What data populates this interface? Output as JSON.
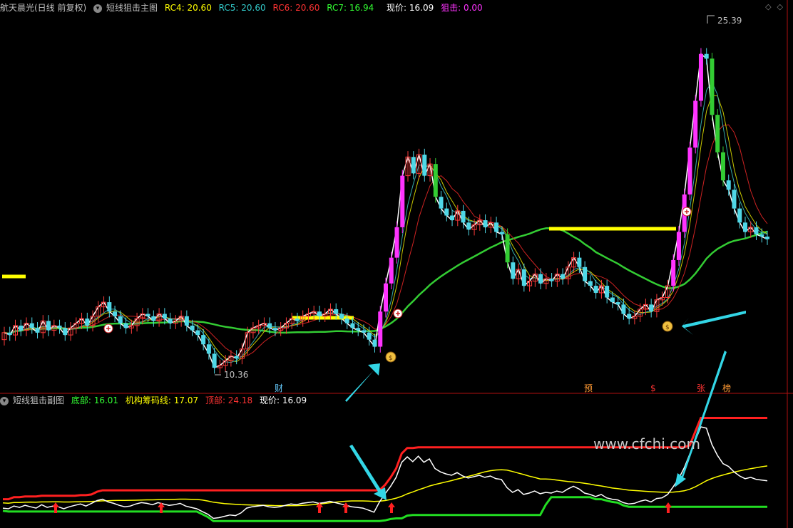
{
  "main_header": {
    "stock_title": "航天晨光(日线 前复权)",
    "indicator_name": "短线狙击主图",
    "rc4_label": "RC4: 20.60",
    "rc5_label": "RC5: 20.60",
    "rc6_label": "RC6: 20.60",
    "rc7_label": "RC7: 16.94",
    "price_label": "现价: 16.09",
    "snipe_label": "狙击: 0.00",
    "colors": {
      "rc4": "#ffff00",
      "rc5": "#33cccc",
      "rc6": "#ff3333",
      "rc7": "#33ff33",
      "price": "#ffffff",
      "snipe": "#ff33ff"
    }
  },
  "sub_header": {
    "indicator_name": "短线狙击副图",
    "bottom_label": "底部: 16.01",
    "chip_label": "机构筹码线: 17.07",
    "top_label": "顶部: 24.18",
    "price_label": "现价: 16.09",
    "colors": {
      "bottom": "#33ff33",
      "chip": "#ffff00",
      "top": "#ff3333",
      "price": "#ffffff"
    }
  },
  "watermark": "www.cfchi.com",
  "corner_icons": [
    "diamond-icon",
    "diamond-icon"
  ],
  "chart_data": [
    {
      "type": "candlestick",
      "title": "短线狙击主图",
      "annotations": {
        "high_label": "25.39",
        "low_label": "10.36"
      },
      "event_markers": [
        "财",
        "预",
        "$",
        "张",
        "榜"
      ],
      "series": [
        {
          "name": "RC4",
          "color": "#ffff00"
        },
        {
          "name": "RC5",
          "color": "#33cccc"
        },
        {
          "name": "RC6",
          "color": "#ff3333"
        },
        {
          "name": "RC7",
          "color": "#33ff33"
        }
      ],
      "closes": [
        12.1,
        12.0,
        12.4,
        12.2,
        12.5,
        12.3,
        12.1,
        12.6,
        12.2,
        12.4,
        12.3,
        12.0,
        12.3,
        12.5,
        12.7,
        12.4,
        12.8,
        13.2,
        13.4,
        13.0,
        12.8,
        12.5,
        12.3,
        12.4,
        12.7,
        12.9,
        12.8,
        12.6,
        12.9,
        12.7,
        12.5,
        12.6,
        12.8,
        12.4,
        12.2,
        12.0,
        11.6,
        11.2,
        10.6,
        10.7,
        10.9,
        11.1,
        11.0,
        11.4,
        12.1,
        12.3,
        12.4,
        12.5,
        12.3,
        12.2,
        12.3,
        12.5,
        12.7,
        12.6,
        12.8,
        12.9,
        13.0,
        12.8,
        12.9,
        13.1,
        12.9,
        12.7,
        12.5,
        12.3,
        12.2,
        12.1,
        11.8,
        11.5,
        13.0,
        14.2,
        15.3,
        16.6,
        18.8,
        19.6,
        18.9,
        19.7,
        18.8,
        19.3,
        17.9,
        17.4,
        17.1,
        16.9,
        17.3,
        16.8,
        16.5,
        16.7,
        16.9,
        16.6,
        16.8,
        16.4,
        16.3,
        15.1,
        14.4,
        14.8,
        14.1,
        14.3,
        14.6,
        14.2,
        14.4,
        14.3,
        14.6,
        14.4,
        14.9,
        15.3,
        14.9,
        14.3,
        14.1,
        13.8,
        14.1,
        13.6,
        13.4,
        13.3,
        12.9,
        12.7,
        12.8,
        13.1,
        13.3,
        13.0,
        13.5,
        13.6,
        14.1,
        15.2,
        16.4,
        18.0,
        20.0,
        22.0,
        24.0,
        23.8,
        21.4,
        19.8,
        18.6,
        18.2,
        17.4,
        16.8,
        16.4,
        16.6,
        16.3,
        16.2,
        16.09
      ]
    },
    {
      "type": "line",
      "title": "短线狙击副图",
      "series": [
        {
          "name": "底部",
          "color": "#33ff33",
          "values": [
            16.01
          ]
        },
        {
          "name": "机构筹码线",
          "color": "#ffff00",
          "values": [
            17.07
          ]
        },
        {
          "name": "顶部",
          "color": "#ff3333",
          "values": [
            24.18
          ]
        },
        {
          "name": "现价",
          "color": "#ffffff",
          "values": [
            16.09
          ]
        }
      ]
    }
  ]
}
